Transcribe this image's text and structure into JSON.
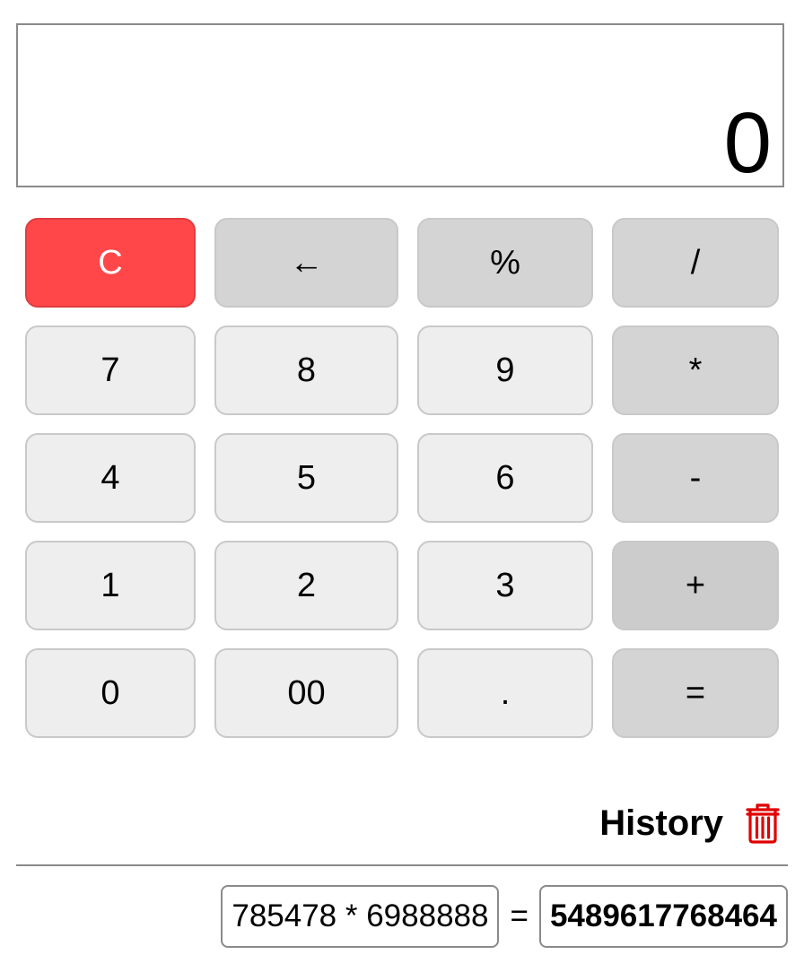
{
  "display": {
    "value": "0"
  },
  "keys": {
    "clear": "C",
    "backspace": "←",
    "percent": "%",
    "divide": "/",
    "seven": "7",
    "eight": "8",
    "nine": "9",
    "multiply": "*",
    "four": "4",
    "five": "5",
    "six": "6",
    "subtract": "-",
    "one": "1",
    "two": "2",
    "three": "3",
    "add": "+",
    "zero": "0",
    "double_zero": "00",
    "decimal": ".",
    "equals": "="
  },
  "history": {
    "title": "History",
    "clear_icon": "trash-icon",
    "entries": [
      {
        "expression": "785478 * 6988888",
        "equals": "=",
        "result": "5489617768464"
      }
    ]
  },
  "colors": {
    "clear_key": "#ff474a",
    "digit_key": "#eeeeee",
    "operator_key": "#d4d4d4",
    "trash_icon": "#e00000"
  }
}
